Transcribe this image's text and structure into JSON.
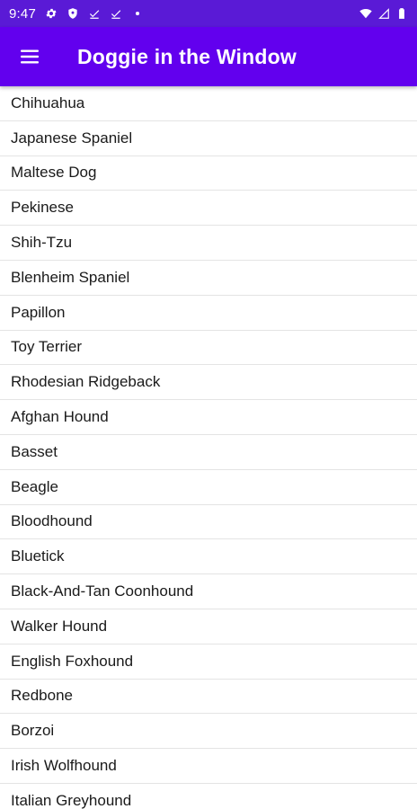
{
  "status_bar": {
    "time": "9:47",
    "left_icons": [
      "settings-icon",
      "shield-icon",
      "check-download-icon",
      "check-download-icon",
      "dot-icon"
    ],
    "right_icons": [
      "wifi-icon",
      "signal-icon",
      "battery-icon"
    ]
  },
  "app_bar": {
    "title": "Doggie in the Window",
    "color": "#6200ee",
    "menu_icon": "menu-icon"
  },
  "breeds": [
    "Chihuahua",
    "Japanese Spaniel",
    "Maltese Dog",
    "Pekinese",
    "Shih-Tzu",
    "Blenheim Spaniel",
    "Papillon",
    "Toy Terrier",
    "Rhodesian Ridgeback",
    "Afghan Hound",
    "Basset",
    "Beagle",
    "Bloodhound",
    "Bluetick",
    "Black-And-Tan Coonhound",
    "Walker Hound",
    "English Foxhound",
    "Redbone",
    "Borzoi",
    "Irish Wolfhound",
    "Italian Greyhound"
  ]
}
